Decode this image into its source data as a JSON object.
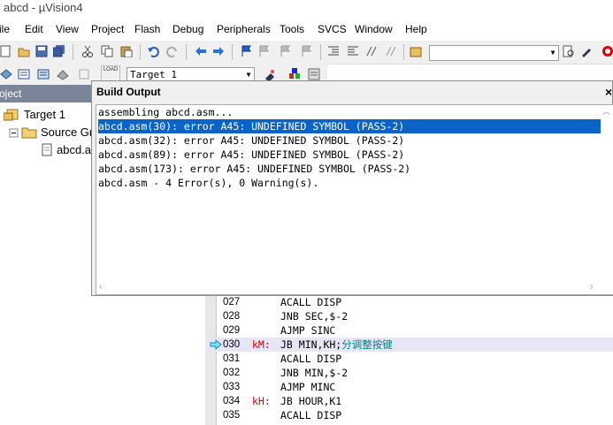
{
  "window": {
    "title": "abcd  - µVision4"
  },
  "menu": [
    {
      "label": "ile"
    },
    {
      "label": "Edit"
    },
    {
      "label": "View"
    },
    {
      "label": "Project"
    },
    {
      "label": "Flash"
    },
    {
      "label": "Debug"
    },
    {
      "label": "Peripherals"
    },
    {
      "label": "Tools"
    },
    {
      "label": "SVCS"
    },
    {
      "label": "Window"
    },
    {
      "label": "Help"
    }
  ],
  "toolbar": {
    "target_select": "Target 1",
    "load_label": "LOAD"
  },
  "project_panel": {
    "header": "oject",
    "tree": [
      {
        "label": "Target 1"
      },
      {
        "label": "Source Gr"
      },
      {
        "label": "abcd.a"
      }
    ]
  },
  "build_output": {
    "title": "Build Output",
    "close": "×",
    "lines": [
      "assembling abcd.asm...",
      "abcd.asm(30): error A45: UNDEFINED SYMBOL (PASS-2)",
      "abcd.asm(32): error A45: UNDEFINED SYMBOL (PASS-2)",
      "abcd.asm(89): error A45: UNDEFINED SYMBOL (PASS-2)",
      "abcd.asm(173): error A45: UNDEFINED SYMBOL (PASS-2)",
      "abcd.asm - 4 Error(s), 0 Warning(s)."
    ],
    "selected_index": 1
  },
  "editor": {
    "lines": [
      {
        "num": "027",
        "label": "",
        "code": "ACALL DISP",
        "comment": ""
      },
      {
        "num": "028",
        "label": "",
        "code": "JNB SEC,$-2",
        "comment": ""
      },
      {
        "num": "029",
        "label": "",
        "code": "AJMP SINC",
        "comment": ""
      },
      {
        "num": "030",
        "label": "kM:",
        "code": "JB MIN,KH;",
        "comment": "分调整按键"
      },
      {
        "num": "031",
        "label": "",
        "code": "ACALL DISP",
        "comment": ""
      },
      {
        "num": "032",
        "label": "",
        "code": "JNB MIN,$-2",
        "comment": ""
      },
      {
        "num": "033",
        "label": "",
        "code": "AJMP MINC",
        "comment": ""
      },
      {
        "num": "034",
        "label": "kH:",
        "code": "JB HOUR,K1",
        "comment": ""
      },
      {
        "num": "035",
        "label": "",
        "code": "ACALL DISP",
        "comment": ""
      }
    ],
    "current_line": "030"
  },
  "colors": {
    "selection": "#0a64c8",
    "panel_header": "#7a8599",
    "label_red": "#cc0000",
    "comment_teal": "#008080",
    "current_line_bg": "#e6e6f7"
  }
}
